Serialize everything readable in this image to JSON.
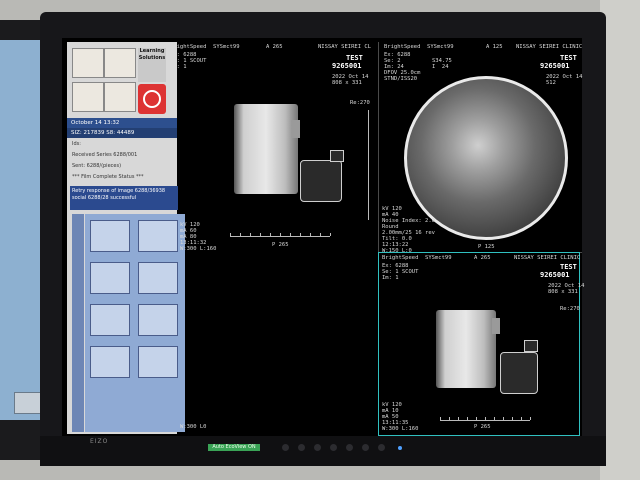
{
  "sidebar": {
    "learning_solutions": "Learning Solutions",
    "date_text": "October 14 13:32",
    "counters": "SIZ: 217839   S8: 44489",
    "ids_label": "Ids:",
    "lines": [
      "Received Series 6288/001",
      "Sent: 6288/(pieces)"
    ],
    "status_line": "*** Film Complete Status ***",
    "message": "Retry response of image 6288/36938\nsocial 6288/28 successful"
  },
  "viewport_main": {
    "scanner": "BrightSpeed  SYSmct99",
    "orientation_top": "A 265",
    "institution": "NISSAY SEIREI CL",
    "exam": "Ex: 6288\nSe: 1 SCOUT\nIm: 1",
    "patient_name": "TEST",
    "patient_id": "9265001",
    "detail_right": "2022 Oct 14\n808 x 331",
    "rotation": "Re:270",
    "params": "kV 120\nmA 60\nmA 80\n13:11:32\nW:300 L:160",
    "bottom_label": "P 265",
    "window": "W:300 L0"
  },
  "viewport_axial": {
    "scanner": "BrightSpeed  SYSmct99",
    "orientation_top": "A 125",
    "institution": "NISSAY SEIREI CLINIC",
    "exam": "Ex: 6288\nSe: 2\nIm: 24\nDFOV 25.0cm\nSTND/ISS20",
    "location": "S34.75\nI  24",
    "patient_name": "TEST",
    "patient_id": "9265001",
    "detail_right": "2022 Oct 14\n512",
    "params": "kV 120\nmA 40\nNoise Index: 2.0\nRound\n2.00mm/25 16 rev\nTilt: 0.0\n12:13:22\nW:150 L:0",
    "bottom_label": "P 125"
  },
  "viewport_scout2": {
    "scanner": "BrightSpeed  SYSmct99",
    "orientation_top": "A 265",
    "institution": "NISSAY SEIREI CLINIC",
    "exam": "Ex: 6288\nSe: 1 SCOUT\nIm: 1",
    "patient_name": "TEST",
    "patient_id": "9265001",
    "detail_right": "2022 Oct 14\n808 x 331",
    "rotation": "Re:270",
    "params": "kV 120\nmA 10\nmA 50\n13:11:35\nW:300 L:160",
    "bottom_label": "P 265"
  },
  "monitor": {
    "brand": "EIZO",
    "power_label": "Auto EcoView ON"
  }
}
